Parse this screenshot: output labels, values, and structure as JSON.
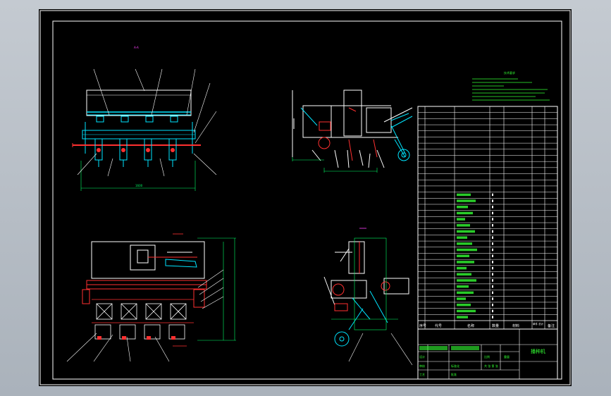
{
  "colors": {
    "background": "#000000",
    "frame": "#ffffff",
    "geometry_cyan": "#00e5ff",
    "dimension_green": "#00ff66",
    "red": "#ff3030",
    "magenta": "#ff40ff",
    "yellow": "#ffff00",
    "notes_green": "#33ff33"
  },
  "drawing": {
    "title": "播种机",
    "notes_title": "技术要求"
  },
  "bom_header": {
    "seq": "序号",
    "code": "代号",
    "name": "名称",
    "qty": "数量",
    "material": "材料",
    "unit": "单件 总计",
    "note": "备注"
  },
  "title_block": {
    "labels": [
      "设计",
      "审核",
      "工艺",
      "标准化",
      "批准",
      "比例",
      "重量",
      "共 张 第 张"
    ]
  }
}
